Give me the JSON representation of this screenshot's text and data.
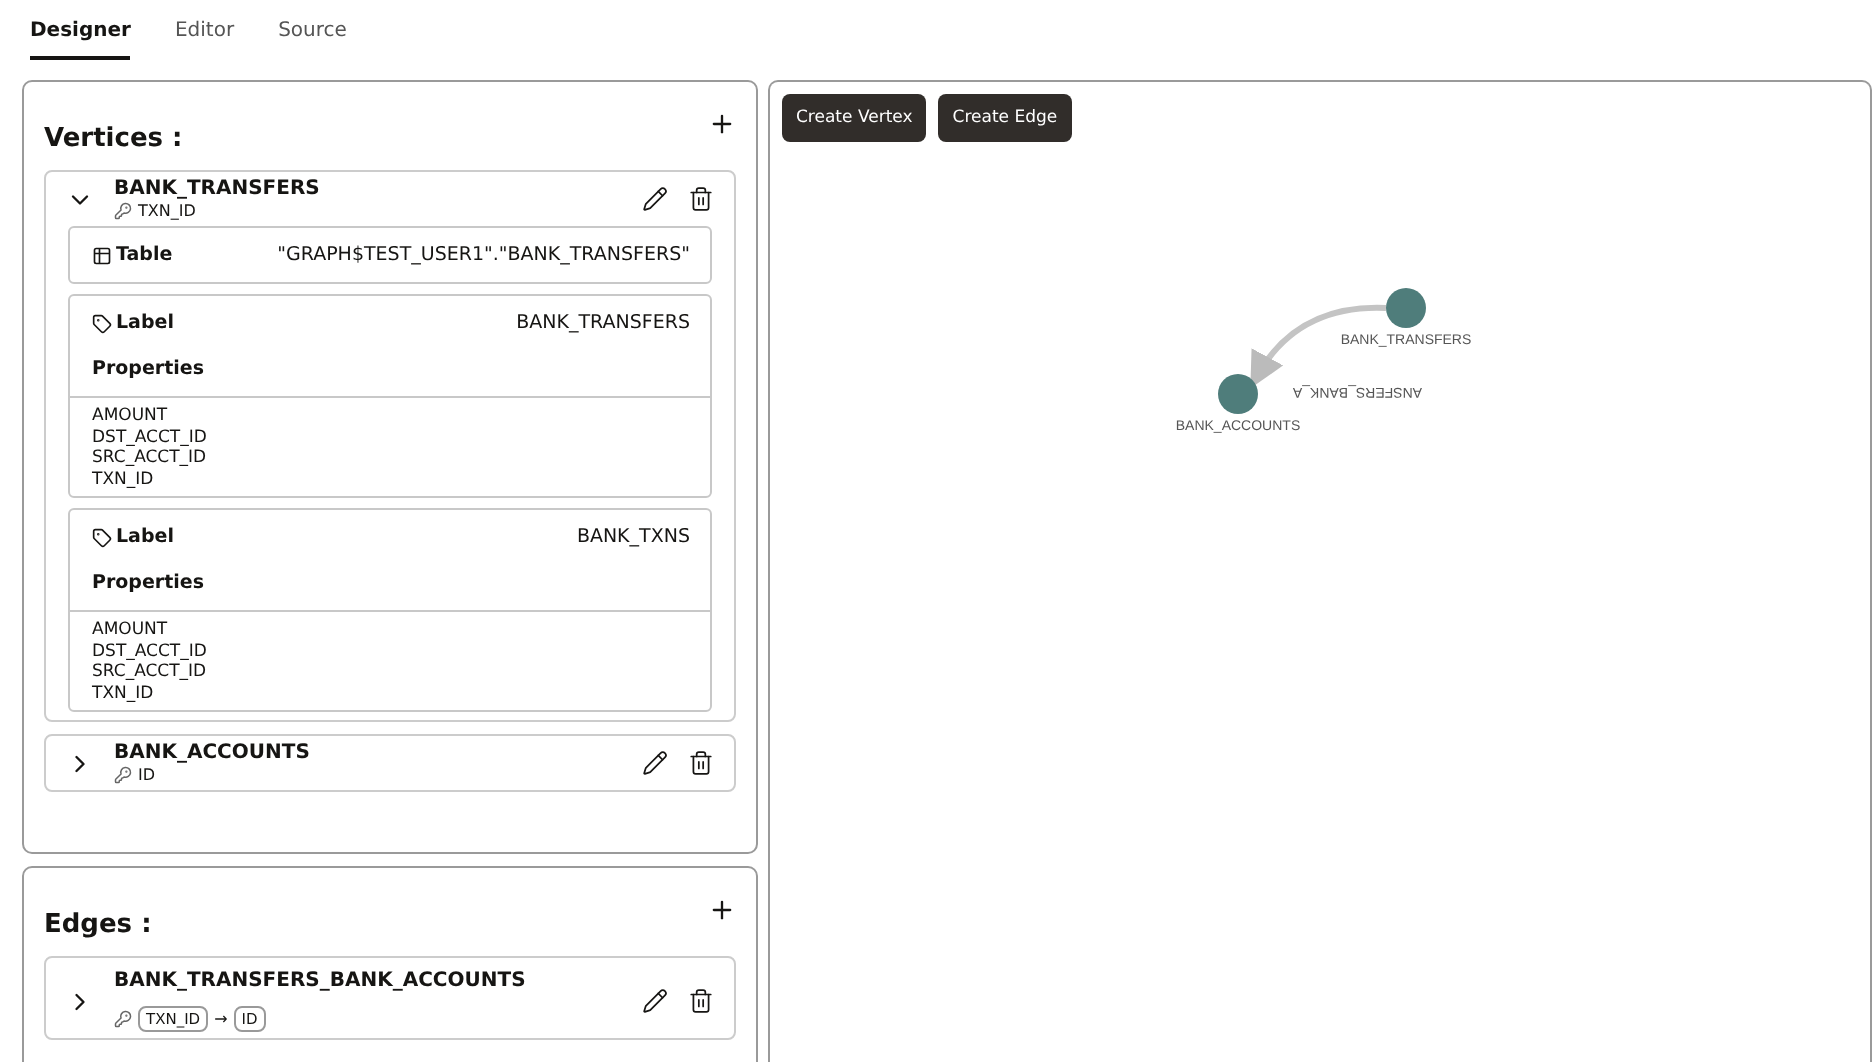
{
  "tabs": [
    {
      "label": "Designer",
      "selected": true
    },
    {
      "label": "Editor",
      "selected": false
    },
    {
      "label": "Source",
      "selected": false
    }
  ],
  "vertices": {
    "title": "Vertices :",
    "items": [
      {
        "name": "BANK_TRANSFERS",
        "key": "TXN_ID",
        "expanded": true,
        "table": {
          "label": "Table",
          "value": "\"GRAPH$TEST_USER1\".\"BANK_TRANSFERS\""
        },
        "labels": [
          {
            "label": "Label",
            "value": "BANK_TRANSFERS",
            "properties_heading": "Properties",
            "properties": [
              "AMOUNT",
              "DST_ACCT_ID",
              "SRC_ACCT_ID",
              "TXN_ID"
            ]
          },
          {
            "label": "Label",
            "value": "BANK_TXNS",
            "properties_heading": "Properties",
            "properties": [
              "AMOUNT",
              "DST_ACCT_ID",
              "SRC_ACCT_ID",
              "TXN_ID"
            ]
          }
        ]
      },
      {
        "name": "BANK_ACCOUNTS",
        "key": "ID",
        "expanded": false
      }
    ]
  },
  "edges": {
    "title": "Edges :",
    "items": [
      {
        "name": "BANK_TRANSFERS_BANK_ACCOUNTS",
        "expanded": false,
        "source_key": "TXN_ID",
        "arrow": "→",
        "destination_key": "ID"
      }
    ]
  },
  "canvas": {
    "buttons": [
      "Create Vertex",
      "Create Edge"
    ],
    "nodes": [
      {
        "label": "BANK_TRANSFERS"
      },
      {
        "label": "BANK_ACCOUNTS"
      }
    ],
    "edge_label": "ANSFERS_BANK_A"
  }
}
